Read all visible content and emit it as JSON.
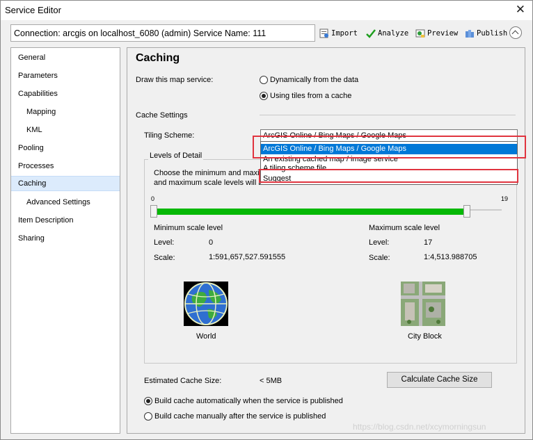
{
  "window": {
    "title": "Service Editor",
    "close": "✕"
  },
  "toolbar": {
    "connection": "Connection: arcgis on localhost_6080 (admin)    Service Name: 111",
    "import_label": "Import",
    "analyze_label": "Analyze",
    "preview_label": "Preview",
    "publish_label": "Publish"
  },
  "sidebar": {
    "items": [
      {
        "label": "General"
      },
      {
        "label": "Parameters"
      },
      {
        "label": "Capabilities"
      },
      {
        "label": "Mapping"
      },
      {
        "label": "KML"
      },
      {
        "label": "Pooling"
      },
      {
        "label": "Processes"
      },
      {
        "label": "Caching"
      },
      {
        "label": "Advanced Settings"
      },
      {
        "label": "Item Description"
      },
      {
        "label": "Sharing"
      }
    ],
    "active": "Caching"
  },
  "caching": {
    "title": "Caching",
    "draw_label": "Draw this map service:",
    "draw_options": [
      "Dynamically from the data",
      "Using tiles from a cache"
    ],
    "draw_selected": "Using tiles from a cache",
    "cache_settings": "Cache Settings",
    "tiling_label": "Tiling Scheme:",
    "tiling_value": "ArcGIS Online / Bing Maps / Google Maps",
    "tiling_options": [
      "ArcGIS Online / Bing Maps / Google Maps",
      "An existing cached map / image service",
      "A tiling scheme file",
      "Suggest"
    ],
    "lod_label": "Levels of Detail",
    "lod_desc_1": "Choose the minimum and maxim",
    "lod_desc_2": "and maximum scale levels will be cached.",
    "slider_min": "0",
    "slider_max": "19",
    "min_label": "Minimum scale level",
    "max_label": "Maximum scale level",
    "level_label": "Level:",
    "scale_label": "Scale:",
    "min_level": "0",
    "min_scale": "1:591,657,527.591555",
    "max_level": "17",
    "max_scale": "1:4,513.988705",
    "world_caption": "World",
    "city_caption": "City Block",
    "est_label": "Estimated Cache Size:",
    "est_value": "< 5MB",
    "calc_button": "Calculate Cache Size",
    "build_options": [
      "Build cache automatically when the service is published",
      "Build cache manually after the service is published"
    ],
    "build_selected": "Build cache automatically when the service is published"
  },
  "watermark": "https://blog.csdn.net/xcymorningsun",
  "colors": {
    "selection": "#0078d7",
    "slider": "#05b805",
    "highlight": "#e0343f",
    "sidebar_active": "#dcebfc"
  }
}
